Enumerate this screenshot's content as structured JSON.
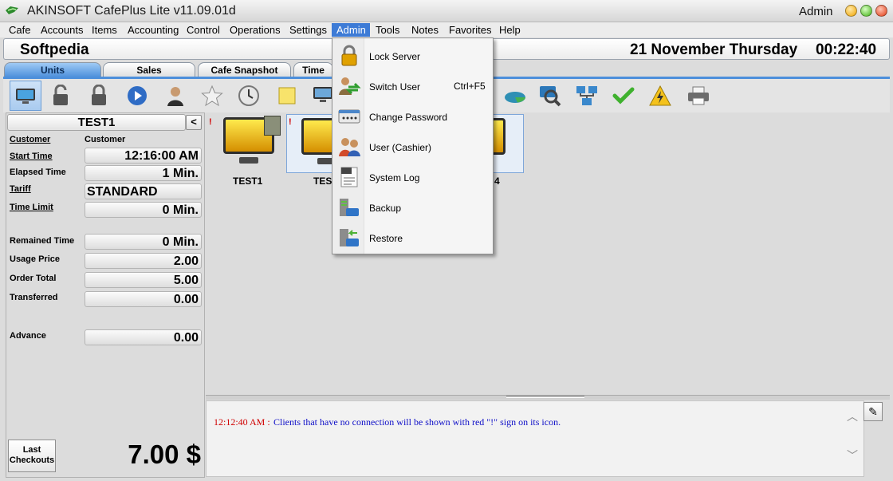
{
  "window": {
    "title": "AKINSOFT CafePlus Lite v11.09.01d",
    "user": "Admin"
  },
  "menu": [
    "Cafe",
    "Accounts",
    "Items",
    "Accounting",
    "Control",
    "Operations",
    "Settings",
    "Admin",
    "Tools",
    "Notes",
    "Favorites",
    "Help"
  ],
  "menu_active": "Admin",
  "header": {
    "brand": "Softpedia",
    "date": "21 November Thursday",
    "time": "00:22:40"
  },
  "tabs": [
    "Units",
    "Sales",
    "Cafe Snapshot",
    "Time"
  ],
  "active_tab": "Units",
  "toolbar_icons": [
    "monitor-icon",
    "unlock-icon",
    "lock-icon",
    "play-icon",
    "user-icon",
    "star-icon",
    "clock-icon",
    "note-icon",
    "computers-icon",
    "chart-icon",
    "search-computer-icon",
    "network-icon",
    "check-icon",
    "power-icon",
    "printer-icon"
  ],
  "unit_panel": {
    "title": "TEST1",
    "collapse_label": "<",
    "customer_label": "Customer",
    "customer_value": "Customer",
    "start_time_label": "Start Time",
    "start_time": "12:16:00 AM",
    "elapsed_label": "Elapsed Time",
    "elapsed": "1 Min.",
    "tariff_label": "Tariff",
    "tariff": "STANDARD",
    "time_limit_label": "Time Limit",
    "time_limit": "0 Min.",
    "remained_label": "Remained Time",
    "remained": "0 Min.",
    "usage_label": "Usage Price",
    "usage": "2.00",
    "order_label": "Order Total",
    "order": "5.00",
    "transferred_label": "Transferred",
    "transferred": "0.00",
    "advance_label": "Advance",
    "advance": "0.00",
    "last_checkouts_label": "Last Checkouts",
    "total": "7.00 $"
  },
  "units": [
    {
      "label": "TEST1",
      "warning": "!"
    },
    {
      "label": "TEST",
      "warning": "!"
    },
    {
      "label": "4",
      "warning": ""
    }
  ],
  "log": {
    "time": "12:12:40 AM :",
    "message": "Clients that have no connection will be shown with red \"!\" sign on its icon."
  },
  "admin_menu": [
    {
      "label": "Lock Server",
      "shortcut": "",
      "icon": "lock-server-icon"
    },
    {
      "label": "Switch User",
      "shortcut": "Ctrl+F5",
      "icon": "switch-user-icon"
    },
    {
      "label": "Change Password",
      "shortcut": "",
      "icon": "password-icon"
    },
    {
      "label": "User  (Cashier)",
      "shortcut": "",
      "icon": "cashier-icon"
    },
    {
      "label": "System Log",
      "shortcut": "",
      "icon": "system-log-icon"
    },
    {
      "label": "Backup",
      "shortcut": "",
      "icon": "backup-icon"
    },
    {
      "label": "Restore",
      "shortcut": "",
      "icon": "restore-icon"
    }
  ],
  "colors": {
    "accent": "#3d7bd6",
    "tab_active": "#4d8fdb",
    "monitor": "#f2c200",
    "warning": "#d00000",
    "log_message": "#1010c8"
  }
}
